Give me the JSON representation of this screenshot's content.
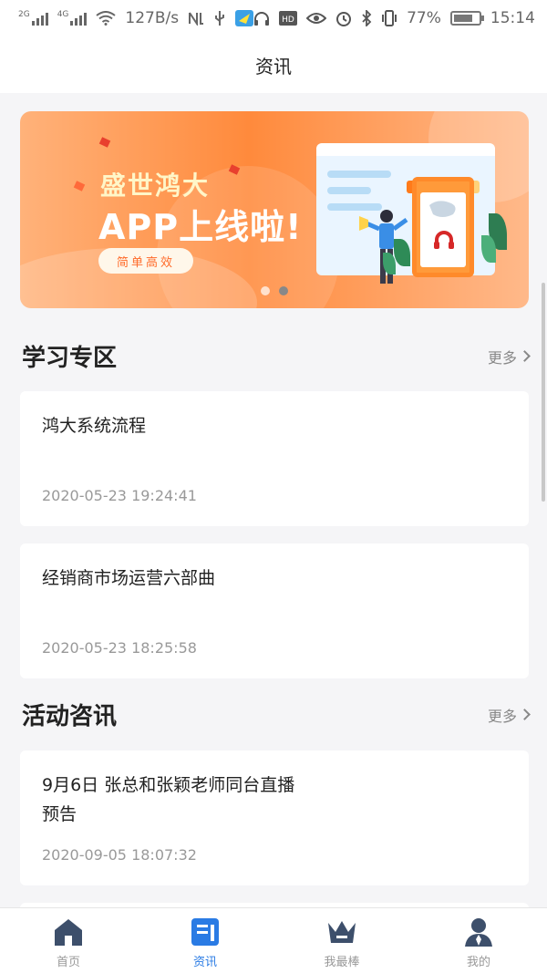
{
  "status_bar": {
    "signal1_label": "2G",
    "signal2_label": "4G",
    "net_speed": "127B/s",
    "battery_percent": "77%",
    "time": "15:14",
    "left_icons": [
      "signal-icon",
      "signal-icon",
      "wifi-icon",
      "nfc-icon",
      "usb-icon",
      "app-icon"
    ],
    "right_icons": [
      "headphones-icon",
      "hd-icon",
      "eye-icon",
      "alarm-icon",
      "bluetooth-icon",
      "vibrate-icon",
      "battery-icon"
    ]
  },
  "navbar": {
    "title": "资讯"
  },
  "banner": {
    "line1": "盛世鸿大",
    "line2": "APP上线啦!",
    "pill": "简单高效",
    "page_count": 2,
    "active_page": 2
  },
  "sections": [
    {
      "title": "学习专区",
      "more": "更多",
      "items": [
        {
          "title": "鸿大系统流程",
          "date": "2020-05-23 19:24:41"
        },
        {
          "title": "经销商市场运营六部曲",
          "date": "2020-05-23 18:25:58"
        }
      ]
    },
    {
      "title": "活动咨讯",
      "more": "更多",
      "items": [
        {
          "title": "9月6日 张总和张颖老师同台直播",
          "title2": "预告",
          "date": "2020-09-05 18:07:32"
        }
      ]
    }
  ],
  "tabbar": {
    "items": [
      {
        "label": "首页",
        "icon": "home-icon",
        "active": false
      },
      {
        "label": "资讯",
        "icon": "news-icon",
        "active": true
      },
      {
        "label": "我最棒",
        "icon": "crown-icon",
        "active": false
      },
      {
        "label": "我的",
        "icon": "user-icon",
        "active": false
      }
    ]
  },
  "colors": {
    "accent": "#2a7be4",
    "tab_inactive": "#3d4f6b",
    "banner_orange": "#ff8a3c"
  }
}
